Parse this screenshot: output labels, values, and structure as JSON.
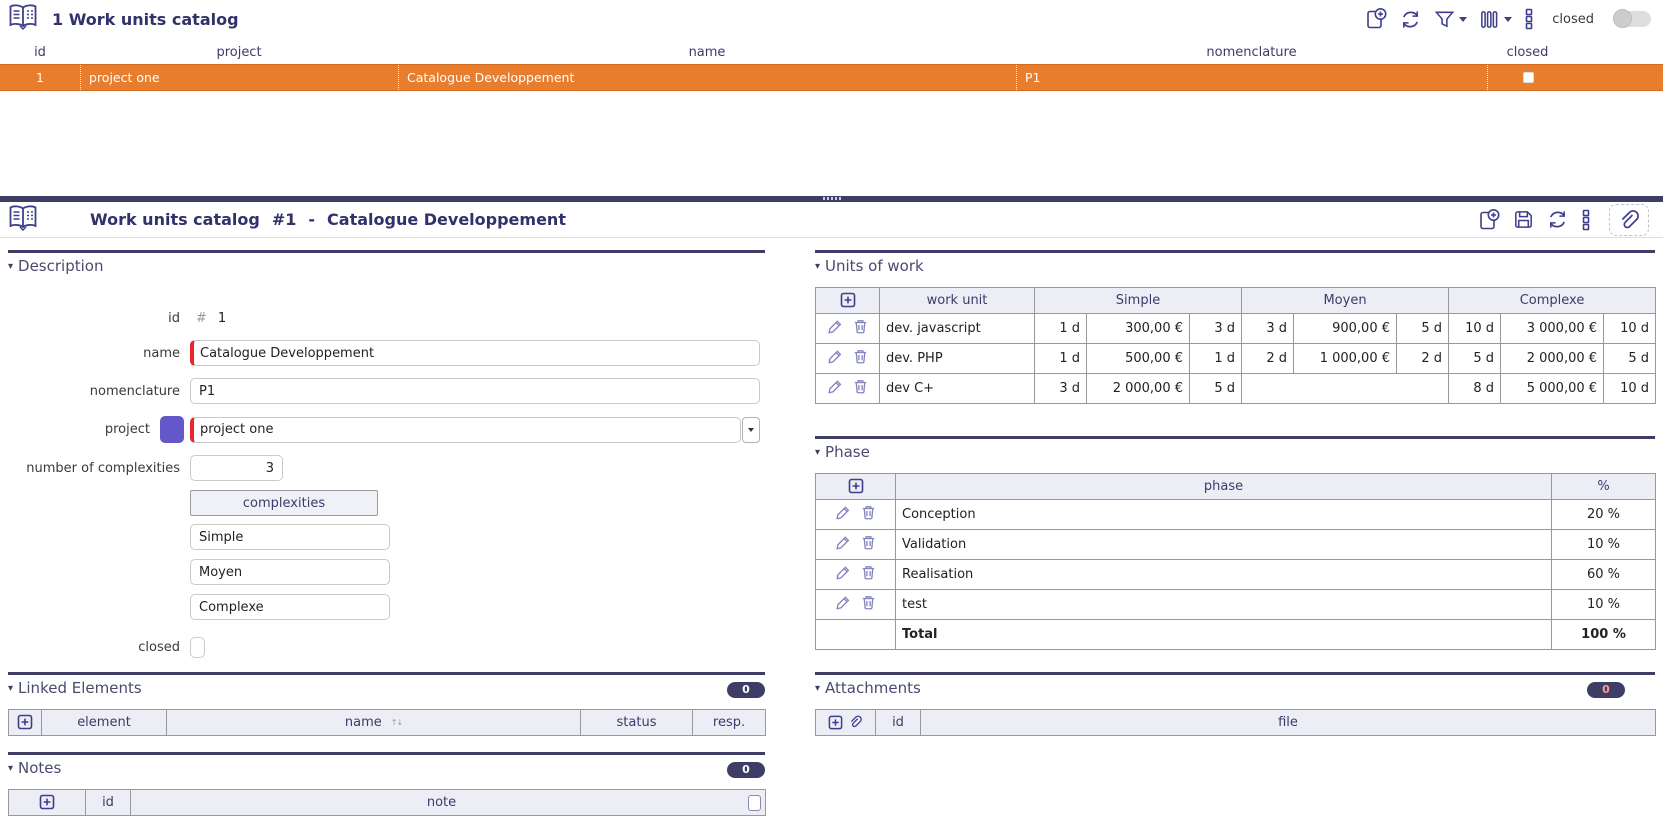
{
  "colors": {
    "accent_navy": "#3d3d66",
    "selected_row_orange": "#e87e2d",
    "required_red": "#e8262c",
    "project_swatch": "#6357c9"
  },
  "list": {
    "title": "1 Work units catalog",
    "closed_label": "closed",
    "columns": {
      "id": "id",
      "project": "project",
      "name": "name",
      "nomenclature": "nomenclature",
      "closed": "closed"
    },
    "row": {
      "id": "1",
      "project": "project one",
      "name": "Catalogue Developpement",
      "nomenclature": "P1"
    }
  },
  "detail": {
    "title_prefix": "Work units catalog",
    "title_id": "#1",
    "title_sep": "-",
    "title_name": "Catalogue Developpement",
    "description": {
      "section": "Description",
      "id_label": "id",
      "id_hash": "#",
      "id_value": "1",
      "name_label": "name",
      "name_value": "Catalogue Developpement",
      "nomenclature_label": "nomenclature",
      "nomenclature_value": "P1",
      "project_label": "project",
      "project_value": "project one",
      "project_color": "#6357c9",
      "noc_label": "number of complexities",
      "noc_value": "3",
      "complexities_header": "complexities",
      "complexity_1": "Simple",
      "complexity_2": "Moyen",
      "complexity_3": "Complexe",
      "closed_label": "closed"
    },
    "units": {
      "section": "Units of work",
      "col_work_unit": "work unit",
      "col_simple": "Simple",
      "col_moyen": "Moyen",
      "col_complexe": "Complexe",
      "rows": [
        {
          "name": "dev. javascript",
          "s1": "1 d",
          "s2": "300,00 €",
          "s3": "3 d",
          "m1": "3 d",
          "m2": "900,00 €",
          "m3": "5 d",
          "c1": "10 d",
          "c2": "3 000,00 €",
          "c3": "10 d"
        },
        {
          "name": "dev. PHP",
          "s1": "1 d",
          "s2": "500,00 €",
          "s3": "1 d",
          "m1": "2 d",
          "m2": "1 000,00 €",
          "m3": "2 d",
          "c1": "5 d",
          "c2": "2 000,00 €",
          "c3": "5 d"
        },
        {
          "name": "dev C+",
          "s1": "3 d",
          "s2": "2 000,00 €",
          "s3": "5 d",
          "c1": "8 d",
          "c2": "5 000,00 €",
          "c3": "10 d"
        }
      ]
    },
    "phase": {
      "section": "Phase",
      "col_phase": "phase",
      "col_pct": "%",
      "rows": [
        {
          "name": "Conception",
          "pct": "20 %"
        },
        {
          "name": "Validation",
          "pct": "10 %"
        },
        {
          "name": "Realisation",
          "pct": "60 %"
        },
        {
          "name": "test",
          "pct": "10 %"
        }
      ],
      "total_label": "Total",
      "total_pct": "100 %"
    },
    "linked": {
      "section": "Linked Elements",
      "badge": "0",
      "col_element": "element",
      "col_name": "name",
      "col_status": "status",
      "col_resp": "resp."
    },
    "attachments": {
      "section": "Attachments",
      "badge": "0",
      "col_id": "id",
      "col_file": "file"
    },
    "notes": {
      "section": "Notes",
      "badge": "0",
      "col_id": "id",
      "col_note": "note"
    }
  }
}
